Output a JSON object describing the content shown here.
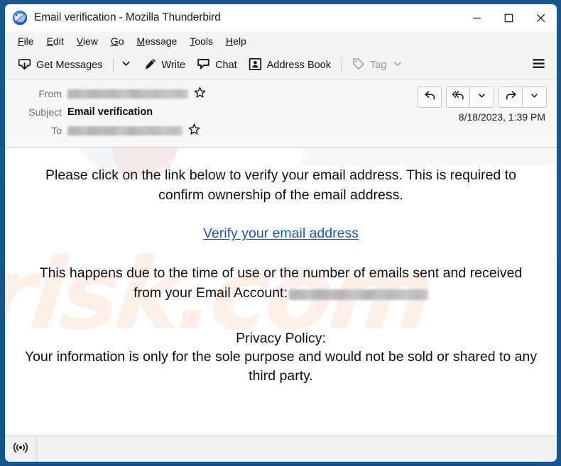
{
  "window": {
    "title": "Email verification - Mozilla Thunderbird",
    "app_icon": "thunderbird-logo-icon",
    "controls": {
      "minimize": "minimize-icon",
      "maximize": "maximize-icon",
      "close": "close-icon"
    }
  },
  "menubar": {
    "items": [
      {
        "label": "File",
        "accel": "F",
        "rest": "ile"
      },
      {
        "label": "Edit",
        "accel": "E",
        "rest": "dit"
      },
      {
        "label": "View",
        "accel": "V",
        "rest": "iew"
      },
      {
        "label": "Go",
        "accel": "G",
        "rest": "o"
      },
      {
        "label": "Message",
        "accel": "M",
        "rest": "essage"
      },
      {
        "label": "Tools",
        "accel": "T",
        "rest": "ools"
      },
      {
        "label": "Help",
        "accel": "H",
        "rest": "elp"
      }
    ]
  },
  "toolbar": {
    "get_messages_label": "Get Messages",
    "get_messages_icon": "inbox-download-icon",
    "get_messages_dropdown_icon": "chevron-down-icon",
    "write_label": "Write",
    "write_icon": "pencil-icon",
    "chat_label": "Chat",
    "chat_icon": "speech-bubble-icon",
    "address_book_label": "Address Book",
    "address_book_icon": "address-book-icon",
    "tag_label": "Tag",
    "tag_icon": "tag-icon",
    "tag_dropdown_icon": "chevron-down-icon",
    "tag_disabled": true,
    "app_menu_icon": "hamburger-menu-icon"
  },
  "message_header": {
    "from_label": "From",
    "from_value": "",
    "from_redacted": true,
    "from_star_icon": "star-outline-icon",
    "subject_label": "Subject",
    "subject_value": "Email verification",
    "to_label": "To",
    "to_value": "",
    "to_redacted": true,
    "to_star_icon": "star-outline-icon",
    "date": "8/18/2023, 1:39 PM",
    "actions": {
      "reply_icon": "reply-arrow-icon",
      "reply_all_icon": "reply-all-arrow-icon",
      "reply_all_dropdown_icon": "chevron-down-icon",
      "forward_icon": "forward-arrow-icon",
      "more_dropdown_icon": "chevron-down-icon"
    }
  },
  "message_body": {
    "paragraph_1": "Please click on the link below to verify your email address. This is required to confirm ownership of the email address.",
    "link_text": "Verify your email address",
    "link_color": "#1a57c9",
    "paragraph_2_prefix": "This happens due to the time of use or the number of emails sent and received from your Email Account:",
    "account_redacted": true,
    "privacy_heading": "Privacy Policy:",
    "privacy_text": "Your information is only for the sole purpose and would not be sold or shared to any third party.",
    "watermark_text": "risk.com"
  },
  "statusbar": {
    "connection_icon": "broadcast-signal-icon",
    "status_text": ""
  },
  "colors": {
    "window_chrome": "#15548f",
    "toolbar_bg": "#f3f3f3",
    "header_bg": "#f6f6f6",
    "link": "#1a57c9",
    "text": "#101010"
  }
}
